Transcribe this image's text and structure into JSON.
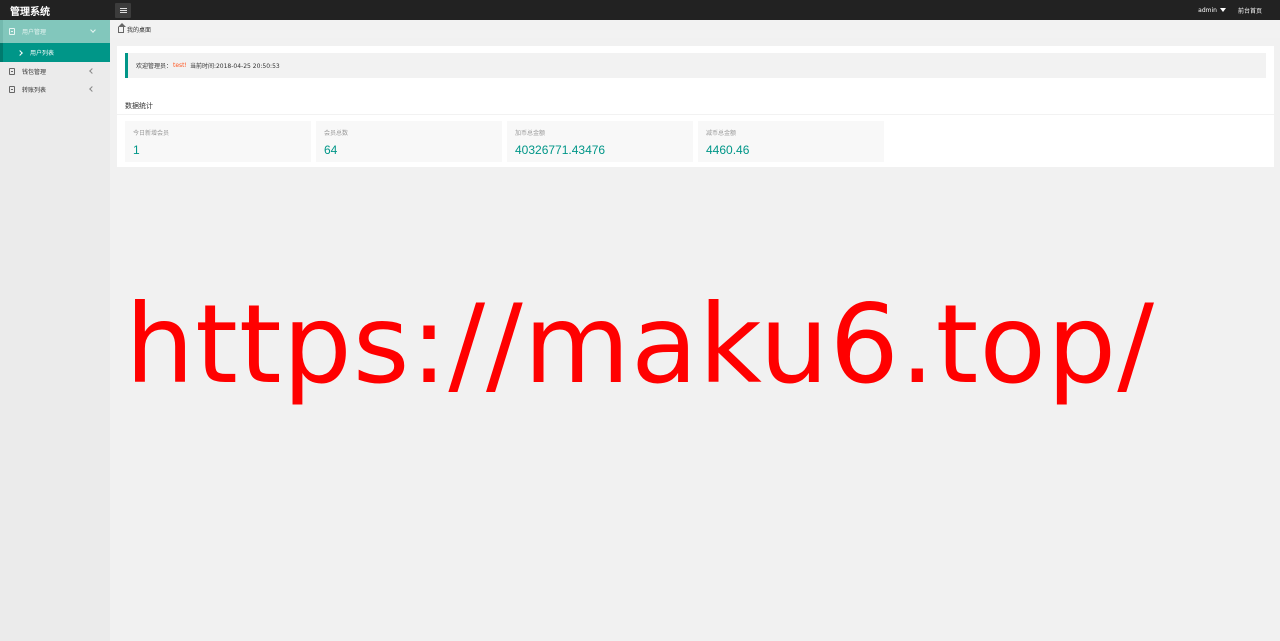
{
  "header": {
    "brand": "管理系统",
    "user": "admin",
    "front_link": "前台首页"
  },
  "sidebar": {
    "items": [
      {
        "label": "用户管理",
        "state": "open"
      },
      {
        "label": "用户列表",
        "state": "active"
      },
      {
        "label": "钱包管理",
        "state": "collapsed"
      },
      {
        "label": "转账列表",
        "state": "collapsed"
      }
    ]
  },
  "breadcrumb": {
    "label": "我的桌面"
  },
  "welcome": {
    "prefix": "欢迎管理员：",
    "username": "test!",
    "time_text": "当前时间:2018-04-25 20:50:53"
  },
  "stats": {
    "title": "数据统计",
    "cards": [
      {
        "label": "今日新增会员",
        "value": "1"
      },
      {
        "label": "会员总数",
        "value": "64"
      },
      {
        "label": "加币总金额",
        "value": "40326771.43476"
      },
      {
        "label": "减币总金额",
        "value": "4460.46"
      }
    ]
  },
  "watermark": "https://maku6.top/",
  "colors": {
    "accent": "#009688",
    "header_bg": "#222222",
    "watermark": "#ff0000",
    "username": "#ff5722"
  }
}
